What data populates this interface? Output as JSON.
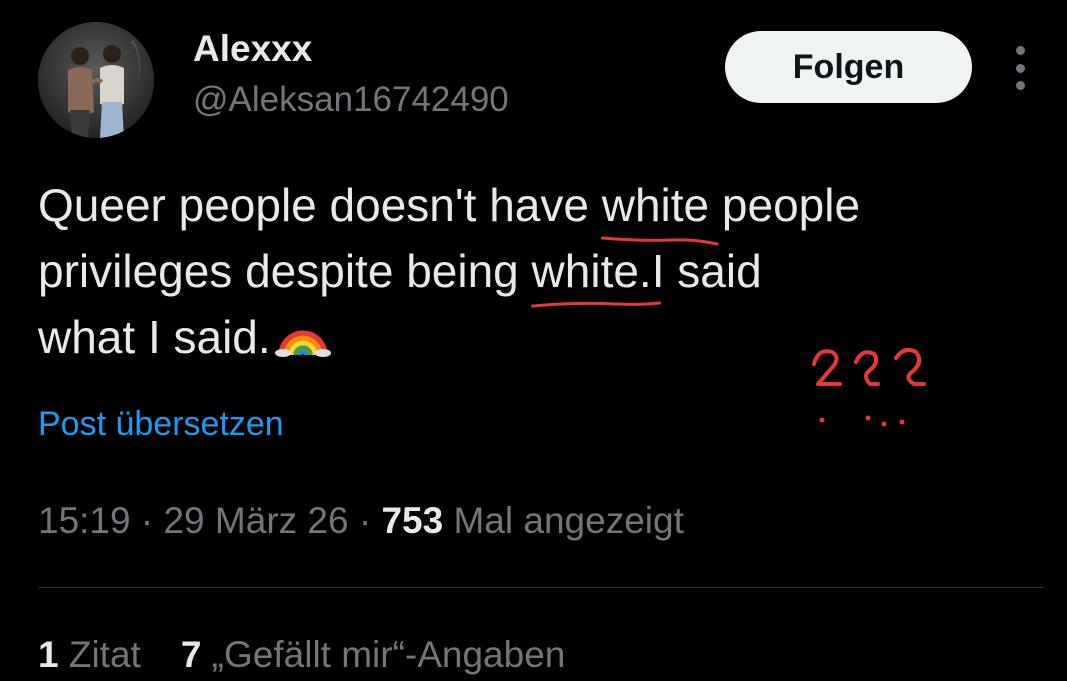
{
  "author": {
    "display_name": "Alexxx",
    "handle": "@Aleksan16742490"
  },
  "follow_button": {
    "label": "Folgen"
  },
  "more_menu": {
    "icon": "more-vertical-icon"
  },
  "tweet": {
    "text_lines": {
      "line1_prefix": "Queer people doesn't have ",
      "line1_underlined": "white",
      "line1_suffix": " people",
      "line2_prefix": "privileges despite being ",
      "line2_underlined": "white.",
      "line2_suffix": "I said",
      "line3": "what I said."
    },
    "emoji": "rainbow-emoji",
    "annotation_marks": "red handwritten question marks"
  },
  "translate_link": {
    "label": "Post übersetzen"
  },
  "meta": {
    "time": "15:19",
    "separator": " · ",
    "date": "29 März 26",
    "views_count": "753",
    "views_label": " Mal angezeigt"
  },
  "stats": {
    "quotes_count": "1",
    "quotes_label": " Zitat",
    "likes_count": "7",
    "likes_label": " „Gefällt mir“-Angaben"
  },
  "colors": {
    "background": "#000000",
    "primary_text": "#e7e9ea",
    "secondary_text": "#71767b",
    "link": "#1d9bf0",
    "annotation_red": "#e53935",
    "button_bg": "#eff3f4"
  }
}
